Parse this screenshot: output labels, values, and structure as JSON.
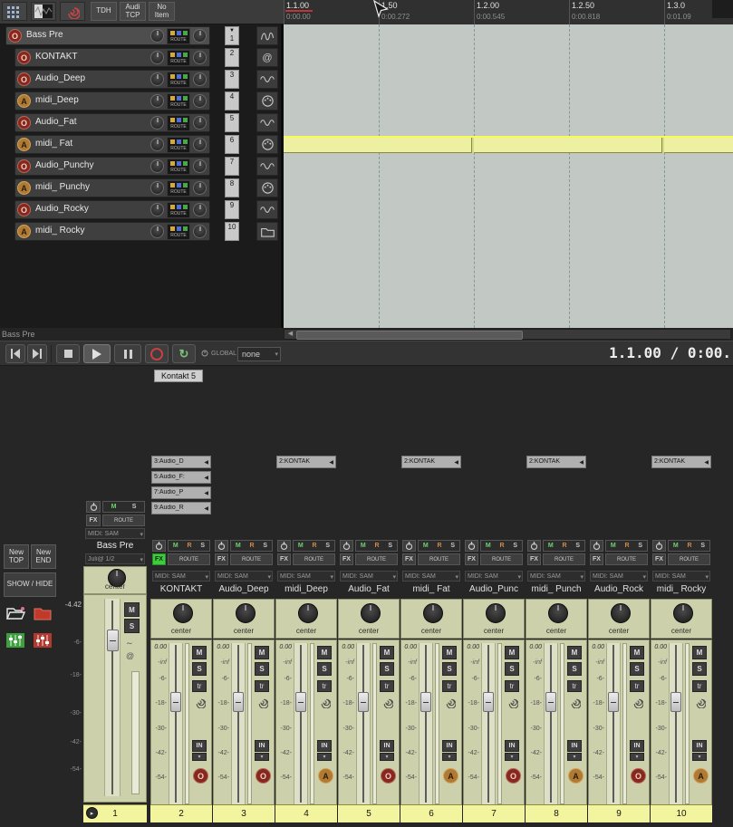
{
  "toolbar": {
    "buttons": [
      {
        "label": "TDH"
      },
      {
        "label": "Audi TCP"
      },
      {
        "label": "No Item"
      }
    ]
  },
  "ruler": {
    "marks": [
      {
        "beat": "1.1.00",
        "time": "0:00.00",
        "cursor": true
      },
      {
        "beat": "1.50",
        "time": "0:00.272"
      },
      {
        "beat": "1.2.00",
        "time": "0:00.545"
      },
      {
        "beat": "1.2.50",
        "time": "0:00.818"
      },
      {
        "beat": "1.3.0",
        "time": "0:01.09"
      }
    ]
  },
  "tcp_common": {
    "route": "ROUTE"
  },
  "tracks": [
    {
      "num": "1",
      "name": "Bass Pre",
      "arm": "O",
      "kind": "audio",
      "selected": true,
      "collapse": true
    },
    {
      "num": "2",
      "name": "KONTAKT",
      "arm": "O",
      "kind": "audio",
      "child": true
    },
    {
      "num": "3",
      "name": "Audio_Deep",
      "arm": "O",
      "kind": "audio",
      "child": true
    },
    {
      "num": "4",
      "name": "midi_Deep",
      "arm": "A",
      "kind": "midi",
      "child": true
    },
    {
      "num": "5",
      "name": "Audio_Fat",
      "arm": "O",
      "kind": "audio",
      "child": true
    },
    {
      "num": "6",
      "name": "midi_ Fat",
      "arm": "A",
      "kind": "midi",
      "child": true
    },
    {
      "num": "7",
      "name": "Audio_Punchy",
      "arm": "O",
      "kind": "audio",
      "child": true
    },
    {
      "num": "8",
      "name": "midi_ Punchy",
      "arm": "A",
      "kind": "midi",
      "child": true
    },
    {
      "num": "9",
      "name": "Audio_Rocky",
      "arm": "O",
      "kind": "audio",
      "child": true
    },
    {
      "num": "10",
      "name": "midi_ Rocky",
      "arm": "A",
      "kind": "midi",
      "child": true
    }
  ],
  "track_icons": [
    {
      "icon": "fx"
    },
    {
      "icon": "at"
    },
    {
      "icon": "wave"
    },
    {
      "icon": "midi"
    },
    {
      "icon": "wave"
    },
    {
      "icon": "midi"
    },
    {
      "icon": "wave"
    },
    {
      "icon": "midi"
    },
    {
      "icon": "wave"
    },
    {
      "icon": "folder"
    }
  ],
  "statusbar": {
    "track_label": "Bass Pre"
  },
  "transport": {
    "global_label": "GLOBAL",
    "global_value": "none",
    "display": "1.1.00 / 0:00.",
    "fx_window_label": "Kontakt 5"
  },
  "dock": {
    "new_top": "New TOP",
    "new_end": "New END",
    "show_hide": "SHOW / HIDE"
  },
  "mixer": {
    "master": {
      "name": "Bass Pre",
      "fx": "FX",
      "route": "ROUTE",
      "mute": "M",
      "solo": "S",
      "midi_input": "MIDI: SAM",
      "output": "Juli@ 1/2",
      "pan": "center",
      "volume": "-4.42",
      "num": "1"
    },
    "strip_common": {
      "fx": "FX",
      "route": "ROUTE",
      "m": "M",
      "r": "R",
      "s": "S",
      "midi_input": "MIDI: SAM",
      "pan": "center",
      "volume": "0.00",
      "peak": "-inf",
      "mute": "M",
      "solo": "S",
      "trim": "tr",
      "input": "IN",
      "scale": [
        "-6-",
        "-18-",
        "-30-",
        "-42-",
        "-54-"
      ]
    },
    "receives": [
      {
        "label": "3:Audio_D"
      },
      {
        "label": "5:Audio_F:"
      },
      {
        "label": "7:Audio_P"
      },
      {
        "label": "9:Audio_R"
      }
    ],
    "strips": [
      {
        "num": "2",
        "name": "KONTAKT",
        "arm": "O",
        "kind": "audio",
        "fx_on": true
      },
      {
        "num": "3",
        "name": "Audio_Deep",
        "arm": "O",
        "kind": "audio"
      },
      {
        "num": "4",
        "name": "midi_Deep",
        "arm": "A",
        "kind": "midi",
        "send": "2:KONTAK"
      },
      {
        "num": "5",
        "name": "Audio_Fat",
        "arm": "O",
        "kind": "audio"
      },
      {
        "num": "6",
        "name": "midi_ Fat",
        "arm": "A",
        "kind": "midi",
        "send": "2:KONTAK"
      },
      {
        "num": "7",
        "name": "Audio_Punc",
        "arm": "O",
        "kind": "audio"
      },
      {
        "num": "8",
        "name": "midi_ Punch",
        "arm": "A",
        "kind": "midi",
        "send": "2:KONTAK"
      },
      {
        "num": "9",
        "name": "Audio_Rock",
        "arm": "O",
        "kind": "audio"
      },
      {
        "num": "10",
        "name": "midi_ Rocky",
        "arm": "A",
        "kind": "midi",
        "send": "2:KONTAK"
      }
    ]
  },
  "colors": {
    "item_yellow": "#edf0a0",
    "number_strip_yellow": "#f3f59e",
    "fx_active_green": "#3ecb3e",
    "record_red": "#87271e",
    "midi_amber": "#b07a33"
  }
}
